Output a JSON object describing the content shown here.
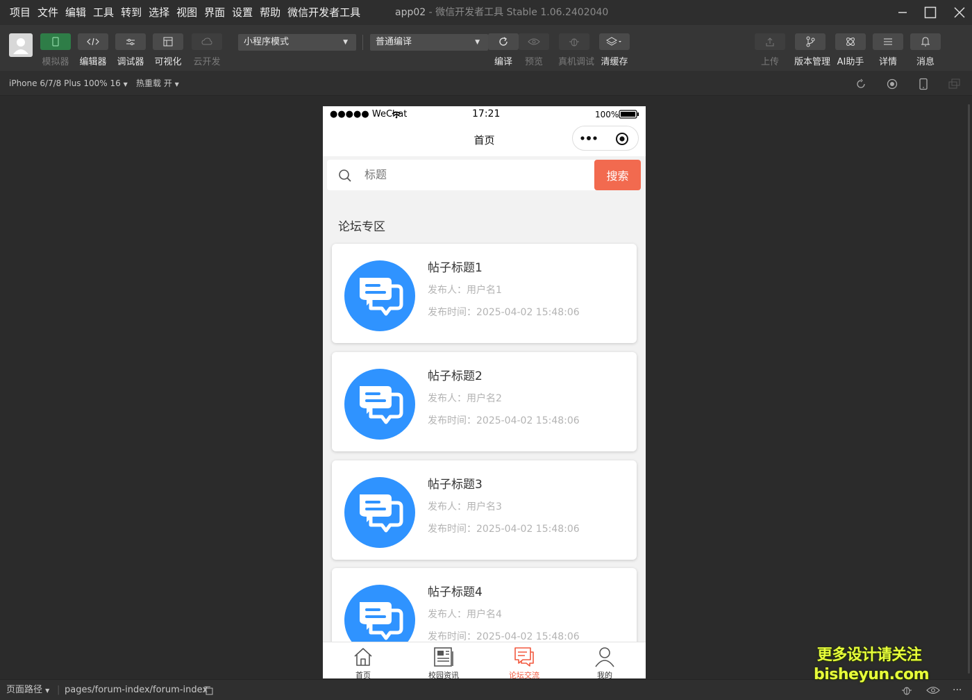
{
  "menu": [
    "项目",
    "文件",
    "编辑",
    "工具",
    "转到",
    "选择",
    "视图",
    "界面",
    "设置",
    "帮助",
    "微信开发者工具"
  ],
  "window": {
    "app_name": "app02",
    "separator": " - ",
    "product": "微信开发者工具 Stable 1.06.2402040"
  },
  "toolbar": {
    "simulator": "模拟器",
    "editor": "编辑器",
    "debugger": "调试器",
    "visual": "可视化",
    "cloud": "云开发",
    "mode_select": "小程序模式",
    "compile_select": "普通编译",
    "compile": "编译",
    "preview": "预览",
    "remote_debug": "真机调试",
    "clear_cache": "清缓存",
    "upload": "上传",
    "version": "版本管理",
    "ai": "AI助手",
    "details": "详情",
    "messages": "消息"
  },
  "subbar": {
    "device": "iPhone 6/7/8 Plus 100% 16",
    "hot_reload": "热重载 开"
  },
  "phone": {
    "status": {
      "carrier": "●●●●● WeChat",
      "time": "17:21",
      "battery": "100%"
    },
    "nav_title": "首页",
    "search": {
      "placeholder": "标题",
      "button": "搜索"
    },
    "section_title": "论坛专区",
    "posts": [
      {
        "title": "帖子标题1",
        "author": "发布人：用户名1",
        "time": "发布时间：2025-04-02 15:48:06"
      },
      {
        "title": "帖子标题2",
        "author": "发布人：用户名2",
        "time": "发布时间：2025-04-02 15:48:06"
      },
      {
        "title": "帖子标题3",
        "author": "发布人：用户名3",
        "time": "发布时间：2025-04-02 15:48:06"
      },
      {
        "title": "帖子标题4",
        "author": "发布人：用户名4",
        "time": "发布时间：2025-04-02 15:48:06"
      }
    ],
    "tabs": [
      {
        "label": "首页",
        "icon": "home-icon"
      },
      {
        "label": "校园资讯",
        "icon": "news-icon"
      },
      {
        "label": "论坛交流",
        "icon": "forum-icon"
      },
      {
        "label": "我的",
        "icon": "user-icon"
      }
    ],
    "active_tab": 2
  },
  "bottom": {
    "page_path_label": "页面路径",
    "page_path": "pages/forum-index/forum-index"
  },
  "watermark": {
    "line1": "更多设计请关注",
    "line2": "bisheyun.com"
  },
  "colors": {
    "accent": "#f26a4f",
    "icon_blue": "#2f93ff",
    "active_tab": "#f2583e",
    "green_btn": "#2e7d47"
  }
}
